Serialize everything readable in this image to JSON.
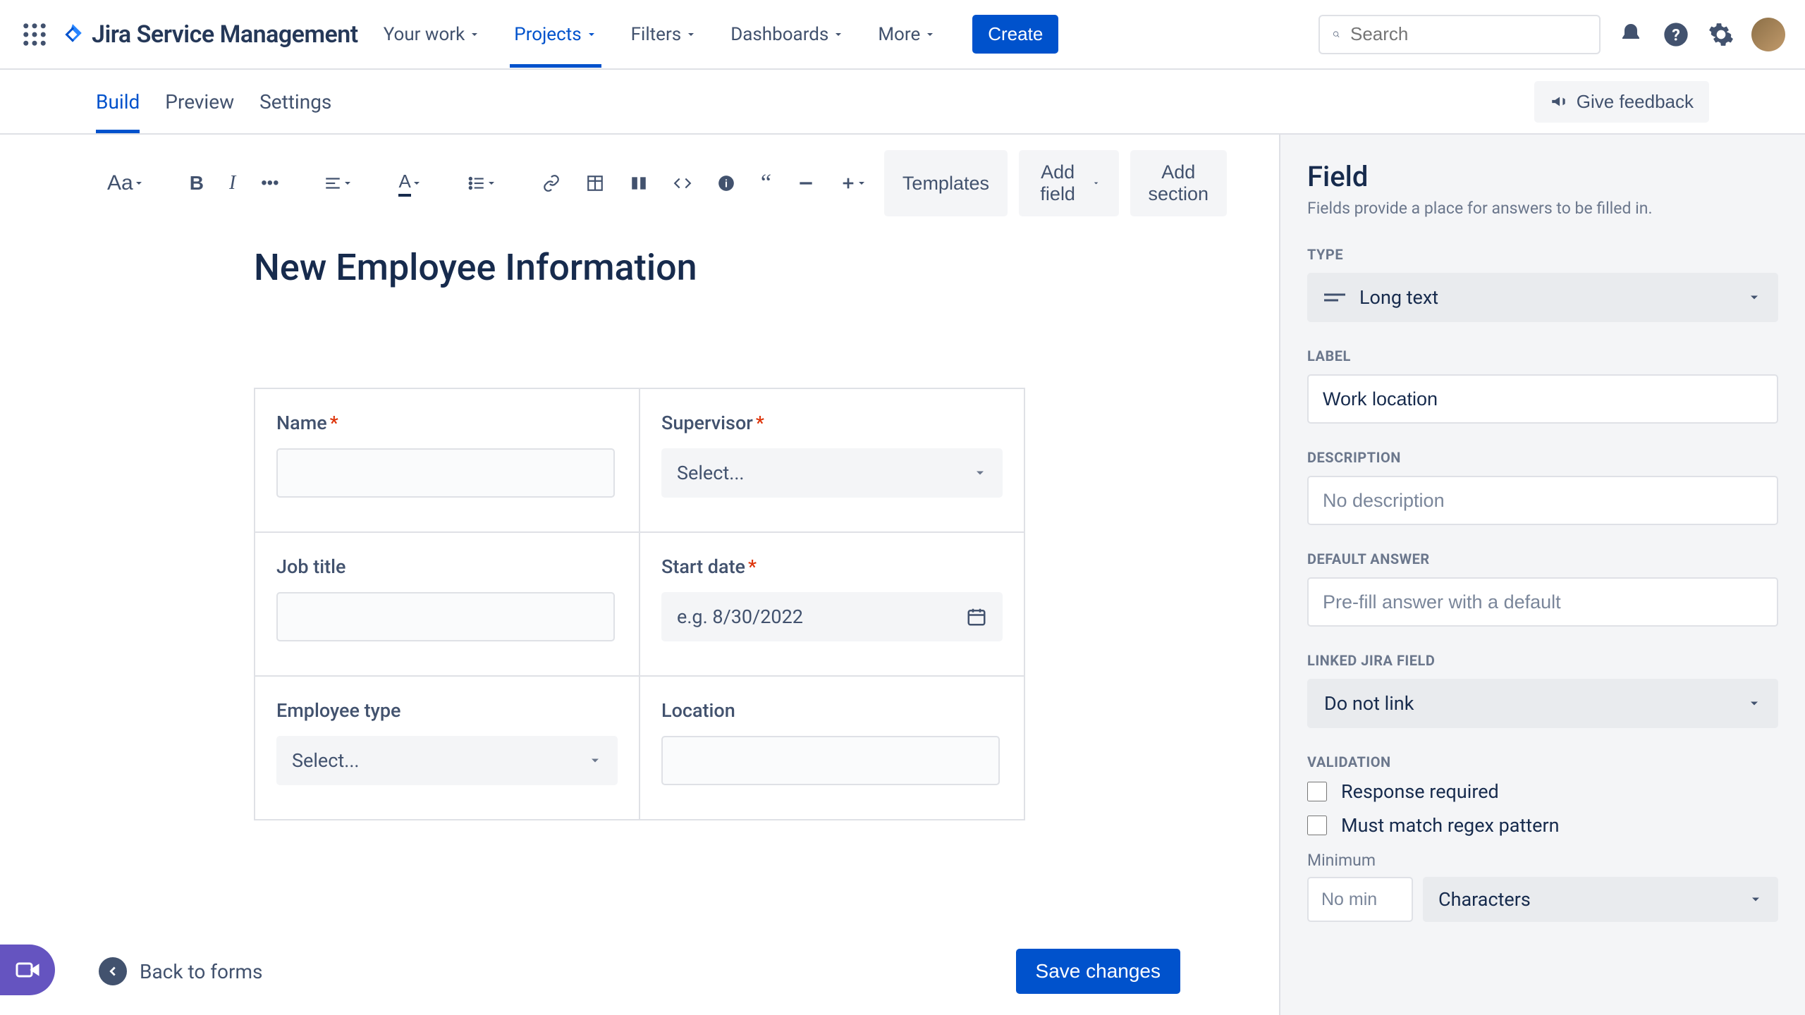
{
  "topnav": {
    "product": "Jira Service Management",
    "items": [
      "Your work",
      "Projects",
      "Filters",
      "Dashboards",
      "More"
    ],
    "active_index": 1,
    "create": "Create",
    "search_placeholder": "Search"
  },
  "subnav": {
    "tabs": [
      "Build",
      "Preview",
      "Settings"
    ],
    "active_index": 0,
    "feedback": "Give feedback"
  },
  "toolbar": {
    "text_style": "Aa",
    "templates": "Templates",
    "add_field": "Add field",
    "add_section": "Add section"
  },
  "canvas": {
    "title": "New Employee Information",
    "fields": {
      "name": {
        "label": "Name",
        "required": true
      },
      "supervisor": {
        "label": "Supervisor",
        "required": true,
        "placeholder": "Select..."
      },
      "job_title": {
        "label": "Job title",
        "required": false
      },
      "start_date": {
        "label": "Start date",
        "required": true,
        "placeholder": "e.g. 8/30/2022"
      },
      "employee_type": {
        "label": "Employee type",
        "required": false,
        "placeholder": "Select..."
      },
      "location": {
        "label": "Location",
        "required": false
      }
    }
  },
  "footer": {
    "back": "Back to forms",
    "save": "Save changes"
  },
  "sidebar": {
    "title": "Field",
    "subtitle": "Fields provide a place for answers to be filled in.",
    "sections": {
      "type": {
        "label": "TYPE",
        "value": "Long text"
      },
      "label": {
        "label": "LABEL",
        "value": "Work location"
      },
      "description": {
        "label": "DESCRIPTION",
        "placeholder": "No description"
      },
      "default_answer": {
        "label": "DEFAULT ANSWER",
        "placeholder": "Pre-fill answer with a default"
      },
      "linked": {
        "label": "LINKED JIRA FIELD",
        "value": "Do not link"
      },
      "validation": {
        "label": "VALIDATION",
        "response_required": "Response required",
        "regex": "Must match regex pattern",
        "minimum_label": "Minimum",
        "min_placeholder": "No min",
        "unit": "Characters"
      }
    }
  }
}
